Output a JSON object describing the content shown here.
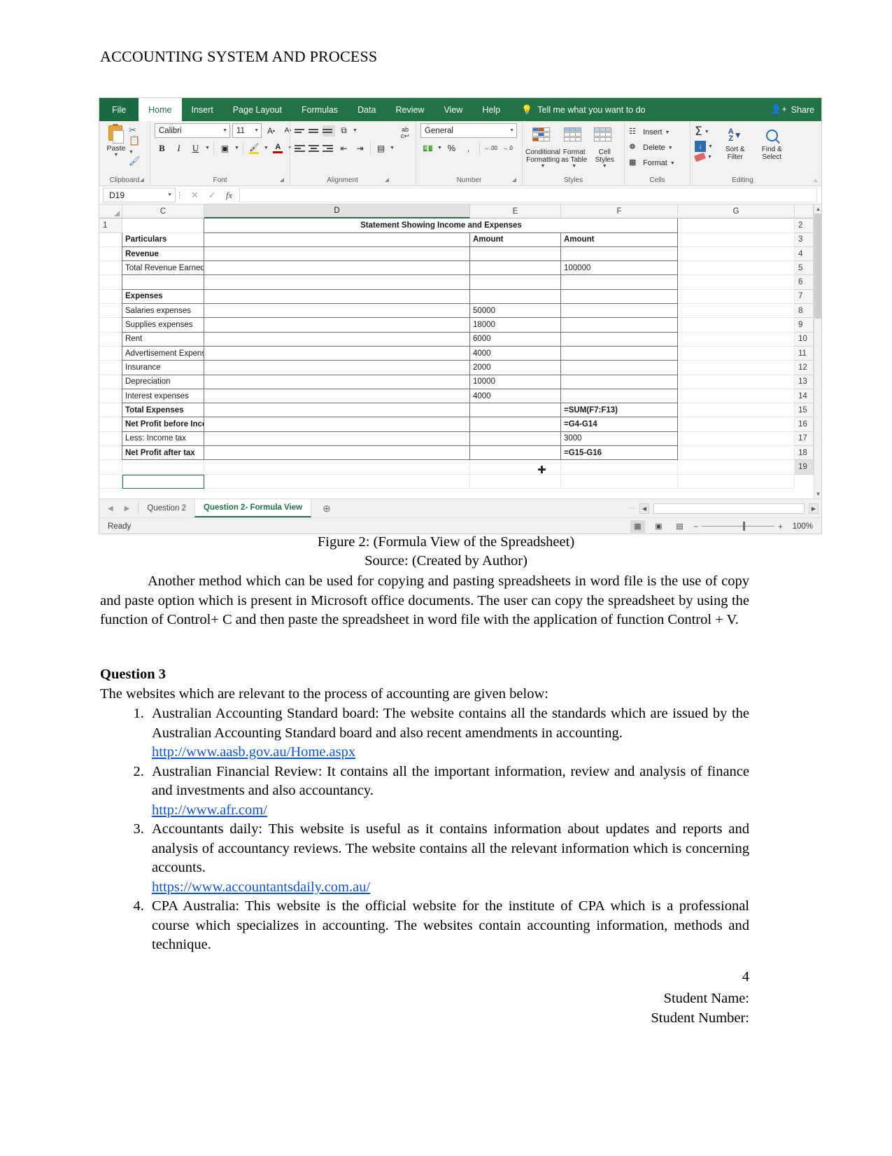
{
  "document": {
    "header": "ACCOUNTING SYSTEM AND PROCESS",
    "figure_caption": "Figure 2: (Formula View of the Spreadsheet)",
    "figure_source": "Source: (Created by Author)",
    "paragraph": "Another method which can be used for copying and pasting spreadsheets in word file is the use of copy and paste option which is present in Microsoft office documents. The user can copy the spreadsheet by using the function of Control+ C and then paste the spreadsheet in word file with the application of function Control + V.",
    "question_heading": "Question 3",
    "question_intro": "The websites which are relevant to the process of accounting are given below:",
    "websites": [
      {
        "text": "Australian Accounting Standard board: The website contains all the standards which are issued by the Australian Accounting Standard board and also recent amendments in accounting.",
        "link": "http://www.aasb.gov.au/Home.aspx"
      },
      {
        "text": "Australian Financial Review: It contains all the important information, review and analysis of finance and investments and also accountancy.",
        "link": "http://www.afr.com/"
      },
      {
        "text": "Accountants daily: This website is useful as it contains information about updates and reports and analysis of accountancy reviews. The website contains all the relevant information which is concerning accounts.",
        "link": "https://www.accountantsdaily.com.au/"
      },
      {
        "text": "CPA Australia: This website is the official website for the institute of CPA which is a professional course which specializes in accounting. The websites contain accounting information, methods and technique.",
        "link": ""
      }
    ],
    "page_number": "4",
    "footer_student_name": "Student Name:",
    "footer_student_number": "Student Number:"
  },
  "excel": {
    "accent_color": "#217346",
    "ribbon_tabs": [
      {
        "label": "File",
        "active": false
      },
      {
        "label": "Home",
        "active": true
      },
      {
        "label": "Insert",
        "active": false
      },
      {
        "label": "Page Layout",
        "active": false
      },
      {
        "label": "Formulas",
        "active": false
      },
      {
        "label": "Data",
        "active": false
      },
      {
        "label": "Review",
        "active": false
      },
      {
        "label": "View",
        "active": false
      },
      {
        "label": "Help",
        "active": false
      }
    ],
    "tell_me": "Tell me what you want to do",
    "share_label": "Share",
    "groups": {
      "clipboard": {
        "label": "Clipboard",
        "paste_label": "Paste"
      },
      "font": {
        "label": "Font",
        "font_name": "Calibri",
        "font_size": "11",
        "bold": "B",
        "italic": "I",
        "underline": "U",
        "grow": "A",
        "shrink": "A"
      },
      "alignment": {
        "label": "Alignment",
        "wrap_text": "ab"
      },
      "number": {
        "label": "Number",
        "format": "General",
        "percent": "%",
        "comma": ",",
        "decrease_decimal": ".00",
        "increase_decimal": ".0"
      },
      "styles": {
        "label": "Styles",
        "conditional_formatting": "Conditional Formatting",
        "format_as_table": "Format as Table",
        "cell_styles": "Cell Styles"
      },
      "cells": {
        "label": "Cells",
        "insert": "Insert",
        "delete": "Delete",
        "format": "Format"
      },
      "editing": {
        "label": "Editing",
        "sort_filter": "Sort & Filter",
        "find_select": "Find & Select"
      }
    },
    "formula_bar": {
      "name_box": "D19",
      "formula_value": "",
      "cancel": "✕",
      "enter": "✓",
      "fx": "fx"
    },
    "column_headers": [
      "C",
      "D",
      "E",
      "F",
      "G"
    ],
    "selected_column": "D",
    "row_numbers": [
      "1",
      "2",
      "3",
      "4",
      "5",
      "6",
      "7",
      "8",
      "9",
      "10",
      "11",
      "12",
      "13",
      "14",
      "15",
      "16",
      "17",
      "18",
      "19"
    ],
    "selected_row": "19",
    "grid_rows": [
      {
        "row": "1",
        "D": "Statement Showing Income and Expenses",
        "E": "",
        "F": "",
        "G": "",
        "style": "title"
      },
      {
        "row": "2",
        "D": "Particulars",
        "E": "",
        "F": "Amount",
        "G": "Amount",
        "style": "bold"
      },
      {
        "row": "3",
        "D": "Revenue",
        "E": "",
        "F": "",
        "G": "",
        "style": "bold"
      },
      {
        "row": "4",
        "D": "Total Revenue Earned",
        "E": "",
        "F": "",
        "G": "100000",
        "style": "normal"
      },
      {
        "row": "5",
        "D": "",
        "E": "",
        "F": "",
        "G": "",
        "style": "normal"
      },
      {
        "row": "6",
        "D": "Expenses",
        "E": "",
        "F": "",
        "G": "",
        "style": "bold"
      },
      {
        "row": "7",
        "D": "Salaries expenses",
        "E": "",
        "F": "50000",
        "G": "",
        "style": "normal"
      },
      {
        "row": "8",
        "D": "Supplies expenses",
        "E": "",
        "F": "18000",
        "G": "",
        "style": "normal"
      },
      {
        "row": "9",
        "D": "Rent",
        "E": "",
        "F": "6000",
        "G": "",
        "style": "normal"
      },
      {
        "row": "10",
        "D": "Advertisement Expense",
        "E": "",
        "F": "4000",
        "G": "",
        "style": "normal"
      },
      {
        "row": "11",
        "D": "Insurance",
        "E": "",
        "F": "2000",
        "G": "",
        "style": "normal"
      },
      {
        "row": "12",
        "D": "Depreciation",
        "E": "",
        "F": "10000",
        "G": "",
        "style": "normal"
      },
      {
        "row": "13",
        "D": "Interest expenses",
        "E": "",
        "F": "4000",
        "G": "",
        "style": "normal"
      },
      {
        "row": "14",
        "D": "Total Expenses",
        "E": "",
        "F": "",
        "G": "=SUM(F7:F13)",
        "style": "bold"
      },
      {
        "row": "15",
        "D": "Net Profit before Income tax",
        "E": "",
        "F": "",
        "G": "=G4-G14",
        "style": "bold"
      },
      {
        "row": "16",
        "D": "Less: Income tax",
        "E": "",
        "F": "",
        "G": "3000",
        "style": "normal"
      },
      {
        "row": "17",
        "D": "Net Profit after tax",
        "E": "",
        "F": "",
        "G": "=G15-G16",
        "style": "bold"
      },
      {
        "row": "18",
        "D": "",
        "E": "",
        "F": "",
        "G": "",
        "style": "empty"
      },
      {
        "row": "19",
        "D": "",
        "E": "",
        "F": "",
        "G": "",
        "style": "selected"
      }
    ],
    "sheet_tabs": [
      {
        "label": "Question 2",
        "active": false
      },
      {
        "label": "Question 2- Formula View",
        "active": true
      }
    ],
    "add_sheet": "+",
    "status": {
      "ready": "Ready",
      "zoom": "100%"
    }
  }
}
